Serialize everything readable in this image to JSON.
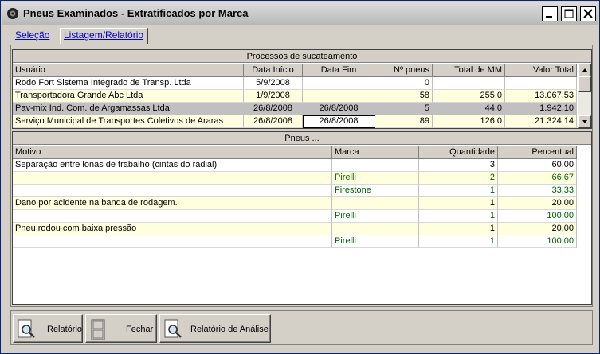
{
  "window": {
    "title": "Pneus Examinados - Extratificados por Marca"
  },
  "tabs": [
    {
      "label": "Seleção"
    },
    {
      "label": "Listagem/Relatório"
    }
  ],
  "processos": {
    "title": "Processos de sucateamento",
    "headers": [
      "Usuário",
      "Data Início",
      "Data Fim",
      "Nº pneus",
      "Total de MM",
      "Valor Total"
    ],
    "rows": [
      [
        "Rodo Fort Sistema Integrado de Transp. Ltda",
        "5/9/2008",
        "",
        "0",
        "",
        ""
      ],
      [
        "Transportadora Grande Abc Ltda",
        "1/9/2008",
        "",
        "58",
        "255,0",
        "13.067,53"
      ],
      [
        "Pav-mix Ind. Com. de Argamassas Ltda",
        "26/8/2008",
        "26/8/2008",
        "5",
        "44,0",
        "1.942,10"
      ],
      [
        "Serviço Municipal de Transportes Coletivos de Araras",
        "26/8/2008",
        "26/8/2008",
        "89",
        "126,0",
        "21.324,14"
      ]
    ]
  },
  "pneus": {
    "title": "Pneus ...",
    "headers": [
      "Motivo",
      "Marca",
      "Quantidade",
      "Percentual"
    ],
    "rows": [
      [
        "Separação entre lonas de trabalho (cintas do radial)",
        "",
        "3",
        "60,00"
      ],
      [
        "",
        "Pirelli",
        "2",
        "66,67"
      ],
      [
        "",
        "Firestone",
        "1",
        "33,33"
      ],
      [
        "Dano por acidente na banda de rodagem.",
        "",
        "1",
        "20,00"
      ],
      [
        "",
        "Pirelli",
        "1",
        "100,00"
      ],
      [
        "Pneu rodou com baixa pressão",
        "",
        "1",
        "20,00"
      ],
      [
        "",
        "Pirelli",
        "1",
        "100,00"
      ]
    ]
  },
  "buttons": {
    "relatorio": "Relatório",
    "fechar": "Fechar",
    "analise": "Relatório de Análise"
  },
  "colors": {
    "row_yellow": "#ffffe0",
    "row_selected": "#c0c0c0",
    "text_green": "#006400",
    "link_blue": "#0000cc"
  },
  "icons": [
    "app-icon",
    "minimize-icon",
    "maximize-icon",
    "close-icon",
    "report-magnifier-icon",
    "door-icon",
    "analysis-magnifier-icon"
  ]
}
